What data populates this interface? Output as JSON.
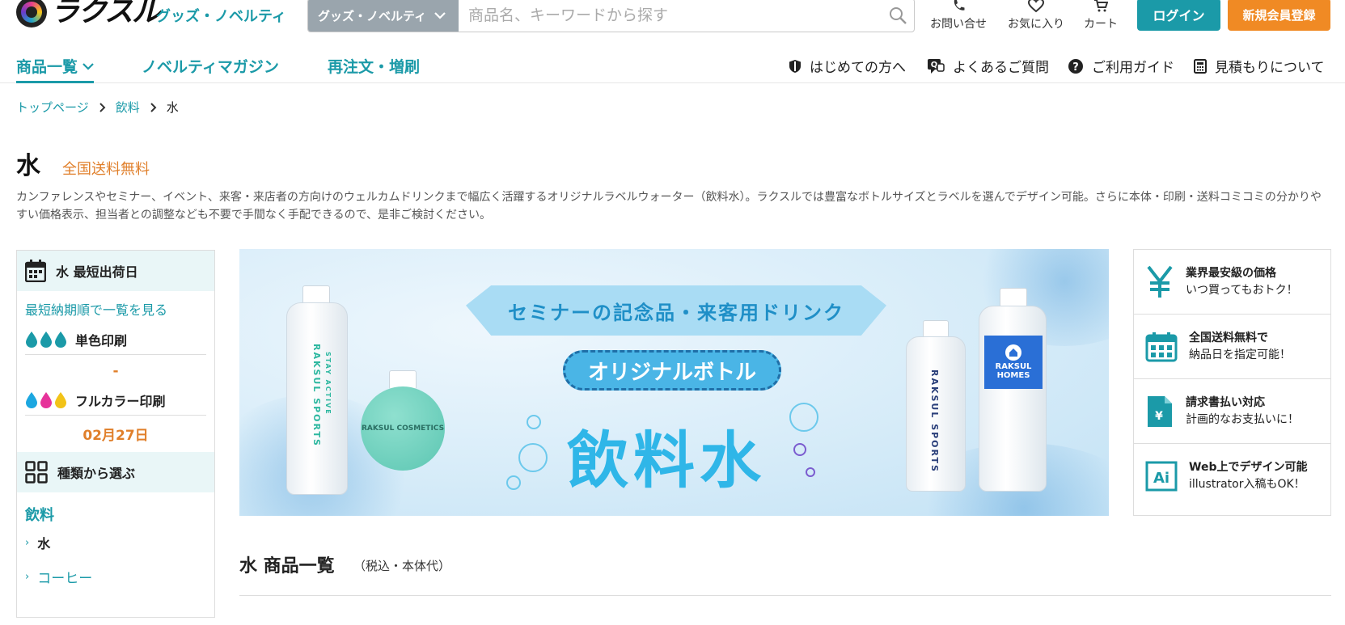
{
  "header": {
    "logo_text": "ラクスル",
    "logo_sub": "グッズ・ノベルティ",
    "search_category": "グッズ・ノベルティ",
    "search_placeholder": "商品名、キーワードから探す",
    "contact_label": "お問い合せ",
    "favorites_label": "お気に入り",
    "cart_label": "カート",
    "login_label": "ログイン",
    "register_label": "新規会員登録"
  },
  "nav": {
    "items": [
      "商品一覧",
      "ノベルティマガジン",
      "再注文・増刷"
    ],
    "right_items": [
      "はじめての方へ",
      "よくあるご質問",
      "ご利用ガイド",
      "見積もりについて"
    ]
  },
  "breadcrumb": [
    "トップページ",
    "飲料",
    "水"
  ],
  "page": {
    "title": "水",
    "free_shipping": "全国送料無料",
    "description": "カンファレンスやセミナー、イベント、来客・来店者の方向けのウェルカムドリンクまで幅広く活躍するオリジナルラベルウォーター（飲料水）。ラクスルでは豊富なボトルサイズとラベルを選んでデザイン可能。さらに本体・印刷・送料コミコミの分かりやすい価格表示、担当者との調整なども不要で手間なく手配できるので、是非ご検討ください。"
  },
  "sidebar": {
    "shipping_head": "水 最短出荷日",
    "shipping_link": "最短納期順で一覧を見る",
    "single_color_label": "単色印刷",
    "single_color_value": "-",
    "full_color_label": "フルカラー印刷",
    "full_color_value": "02月27日",
    "category_head": "種類から選ぶ",
    "category": "飲料",
    "sub_items": [
      "水",
      "コーヒー"
    ]
  },
  "banner": {
    "ribbon": "セミナーの記念品・来客用ドリンク",
    "pill": "オリジナルボトル",
    "headline": "飲料水",
    "bottle1": "RAKSUL SPORTS",
    "bottle1_sub": "STAY ACTIVE",
    "bottle2": "RAKSUL COSMETICS",
    "bottle3": "RAKSUL SPORTS",
    "bottle4": "RAKSUL HOMES"
  },
  "features": [
    {
      "icon": "yen-icon",
      "title": "業界最安級の価格",
      "sub": "いつ買ってもおトク！"
    },
    {
      "icon": "calendar-check-icon",
      "title": "全国送料無料で",
      "sub": "納品日を指定可能！"
    },
    {
      "icon": "invoice-icon",
      "title": "請求書払い対応",
      "sub": "計画的なお支払いに！"
    },
    {
      "icon": "ai-icon",
      "title": "Web上でデザイン可能",
      "sub": "illustrator入稿もOK！"
    }
  ],
  "product_list": {
    "title": "水 商品一覧",
    "note": "（税込・本体代）"
  },
  "colors": {
    "accent": "#1b9aa8",
    "orange": "#f08a24",
    "search_category_bg": "#9aa5ad"
  }
}
